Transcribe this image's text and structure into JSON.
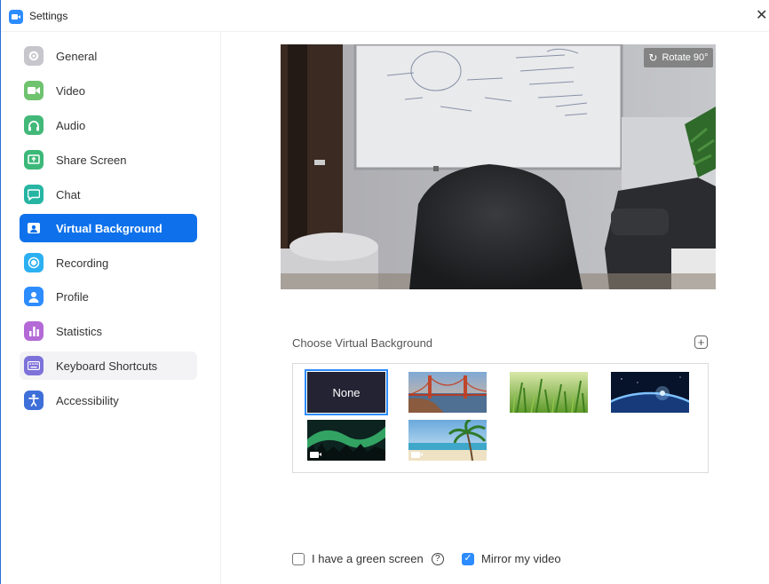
{
  "window": {
    "title": "Settings"
  },
  "sidebar": {
    "items": [
      {
        "label": "General",
        "color": "#c6c6cc",
        "icon": "gear-icon"
      },
      {
        "label": "Video",
        "color": "#6fc36f",
        "icon": "video-camera-icon"
      },
      {
        "label": "Audio",
        "color": "#42b879",
        "icon": "headphones-icon"
      },
      {
        "label": "Share Screen",
        "color": "#3cb878",
        "icon": "share-screen-icon"
      },
      {
        "label": "Chat",
        "color": "#26b5a3",
        "icon": "chat-bubble-icon"
      },
      {
        "label": "Virtual Background",
        "color": "#ffffff",
        "icon": "virtual-background-icon"
      },
      {
        "label": "Recording",
        "color": "#2bb0f2",
        "icon": "recording-icon"
      },
      {
        "label": "Profile",
        "color": "#2d8cff",
        "icon": "profile-icon"
      },
      {
        "label": "Statistics",
        "color": "#b46ad6",
        "icon": "statistics-icon"
      },
      {
        "label": "Keyboard Shortcuts",
        "color": "#7d72d9",
        "icon": "keyboard-icon"
      },
      {
        "label": "Accessibility",
        "color": "#3f6fd8",
        "icon": "accessibility-icon"
      }
    ],
    "active": "Virtual Background",
    "active_color": "#0e71eb"
  },
  "preview": {
    "rotate_label": "Rotate 90°"
  },
  "backgrounds": {
    "section_label": "Choose Virtual Background",
    "add_symbol": "+",
    "none_label": "None",
    "items": [
      "golden-gate-bridge",
      "green-grass",
      "earth-from-space",
      "aurora-borealis",
      "beach-palm-tree"
    ]
  },
  "options": {
    "green_screen_label": "I have a green screen",
    "green_screen_checked": false,
    "help_symbol": "?",
    "mirror_label": "Mirror my video",
    "mirror_checked": true,
    "check_symbol": "✓"
  }
}
